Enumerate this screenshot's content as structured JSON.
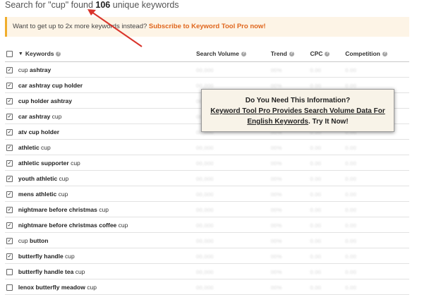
{
  "search_summary": {
    "prefix": "Search for \"cup\" found",
    "count": "106",
    "suffix": "unique keywords"
  },
  "promo": {
    "text": "Want to get up to 2x more keywords instead?",
    "link": "Subscribe to Keyword Tool Pro now!"
  },
  "columns": {
    "keywords": "Keywords",
    "search_volume": "Search Volume",
    "trend": "Trend",
    "cpc": "CPC",
    "competition": "Competition"
  },
  "help_glyph": "?",
  "sort_glyph": "▼",
  "rows": [
    {
      "checked": true,
      "parts": [
        [
          "cup",
          false
        ],
        [
          " ashtray",
          true
        ]
      ],
      "search_volume": "00,000",
      "trend": "00%",
      "cpc": "0.00",
      "competition": "0.00"
    },
    {
      "checked": true,
      "parts": [
        [
          "car ashtray cup holder",
          true
        ]
      ],
      "search_volume": "00,000",
      "trend": "00%",
      "cpc": "0.00",
      "competition": "0.00"
    },
    {
      "checked": true,
      "parts": [
        [
          "cup holder ashtray",
          true
        ]
      ],
      "search_volume": "00,000",
      "trend": "00%",
      "cpc": "0.00",
      "competition": "0.00"
    },
    {
      "checked": true,
      "parts": [
        [
          "car ashtray ",
          true
        ],
        [
          "cup",
          false
        ]
      ],
      "search_volume": "00,000",
      "trend": "00%",
      "cpc": "0.00",
      "competition": "0.00"
    },
    {
      "checked": true,
      "parts": [
        [
          "atv cup holder",
          true
        ]
      ],
      "search_volume": "00,000",
      "trend": "00%",
      "cpc": "0.00",
      "competition": "0.00"
    },
    {
      "checked": true,
      "parts": [
        [
          "athletic",
          true
        ],
        [
          " cup",
          false
        ]
      ],
      "search_volume": "00,000",
      "trend": "00%",
      "cpc": "0.00",
      "competition": "0.00"
    },
    {
      "checked": true,
      "parts": [
        [
          "athletic supporter",
          true
        ],
        [
          " cup",
          false
        ]
      ],
      "search_volume": "00,000",
      "trend": "00%",
      "cpc": "0.00",
      "competition": "0.00"
    },
    {
      "checked": true,
      "parts": [
        [
          "youth athletic",
          true
        ],
        [
          " cup",
          false
        ]
      ],
      "search_volume": "00,000",
      "trend": "00%",
      "cpc": "0.00",
      "competition": "0.00"
    },
    {
      "checked": true,
      "parts": [
        [
          "mens athletic",
          true
        ],
        [
          " cup",
          false
        ]
      ],
      "search_volume": "00,000",
      "trend": "00%",
      "cpc": "0.00",
      "competition": "0.00"
    },
    {
      "checked": true,
      "parts": [
        [
          "nightmare before christmas",
          true
        ],
        [
          " cup",
          false
        ]
      ],
      "search_volume": "00,000",
      "trend": "00%",
      "cpc": "0.00",
      "competition": "0.00"
    },
    {
      "checked": true,
      "parts": [
        [
          "nightmare before christmas coffee",
          true
        ],
        [
          " cup",
          false
        ]
      ],
      "search_volume": "00,000",
      "trend": "00%",
      "cpc": "0.00",
      "competition": "0.00"
    },
    {
      "checked": true,
      "parts": [
        [
          "cup",
          false
        ],
        [
          " button",
          true
        ]
      ],
      "search_volume": "00,000",
      "trend": "00%",
      "cpc": "0.00",
      "competition": "0.00"
    },
    {
      "checked": true,
      "parts": [
        [
          "butterfly handle",
          true
        ],
        [
          " cup",
          false
        ]
      ],
      "search_volume": "00,000",
      "trend": "00%",
      "cpc": "0.00",
      "competition": "0.00"
    },
    {
      "checked": false,
      "parts": [
        [
          "butterfly handle tea",
          true
        ],
        [
          " cup",
          false
        ]
      ],
      "search_volume": "00,000",
      "trend": "00%",
      "cpc": "0.00",
      "competition": "0.00"
    },
    {
      "checked": false,
      "parts": [
        [
          "lenox butterfly meadow",
          true
        ],
        [
          " cup",
          false
        ]
      ],
      "search_volume": "00,000",
      "trend": "00%",
      "cpc": "0.00",
      "competition": "0.00"
    }
  ],
  "popup": {
    "line1": "Do You Need This Information?",
    "link": "Keyword Tool Pro Provides Search Volume Data For English Keywords",
    "suffix": ". Try It Now!"
  },
  "colors": {
    "promo_accent": "#f0ad2c",
    "link": "#e0661d",
    "arrow": "#d9342b"
  }
}
